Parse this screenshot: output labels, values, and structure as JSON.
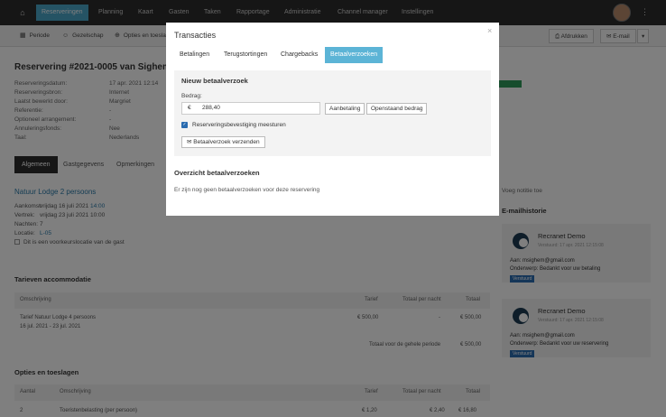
{
  "nav": {
    "items": [
      "Reserveringen",
      "Planning",
      "Kaart",
      "Gasten",
      "Taken",
      "Rapportage",
      "Administratie",
      "Channel manager",
      "Instellingen"
    ]
  },
  "subbar": {
    "periode": "Periode",
    "gezelschap": "Gezelschap",
    "opties": "Opties en toesla",
    "afdrukken": "Afdrukken",
    "email": "E-mail"
  },
  "reservation": {
    "title": "Reservering #2021-0005 van Sighem",
    "fields": [
      {
        "label": "Reserveringsdatum:",
        "value": "17 apr. 2021 12:14"
      },
      {
        "label": "Reserveringsbron:",
        "value": "Internet"
      },
      {
        "label": "Laatst bewerkt door:",
        "value": "Margriet"
      },
      {
        "label": "Referentie:",
        "value": "-"
      },
      {
        "label": "Optioneel arrangement:",
        "value": "-"
      },
      {
        "label": "Annuleringsfonds:",
        "value": "Nee"
      },
      {
        "label": "Taal:",
        "value": "Nederlands"
      }
    ],
    "tabs": [
      "Algemeen",
      "Gastgegevens",
      "Opmerkingen"
    ],
    "accommodation": "Natuur Lodge 2 persoons",
    "details": [
      {
        "label": "Aankomst:",
        "value": "vrijdag 16 juli 2021",
        "time": "14:00"
      },
      {
        "label": "Vertrek:",
        "value": "vrijdag 23 juli 2021 10:00",
        "time": ""
      },
      {
        "label": "Nachten:",
        "value": "7",
        "time": ""
      },
      {
        "label": "Locatie:",
        "value": "L-05",
        "time": ""
      }
    ],
    "preference": "Dit is een voorkeurslocatie van de gast"
  },
  "rates": {
    "title": "Tarieven accommodatie",
    "headers": [
      "Omschrijving",
      "Tarief",
      "Totaal per nacht",
      "Totaal"
    ],
    "row": {
      "desc": "Tarief Natuur Lodge 4 persoons",
      "dates": "16 jul. 2021 - 23 jul. 2021",
      "tarief": "€ 500,00",
      "per_nacht": "-",
      "totaal": "€ 500,00"
    },
    "total_label": "Totaal voor de gehele periode",
    "total_value": "€ 500,00"
  },
  "options": {
    "title": "Opties en toeslagen",
    "headers": [
      "Aantal",
      "Omschrijving",
      "Tarief",
      "Totaal per nacht",
      "Totaal"
    ],
    "row": {
      "aantal": "2",
      "desc": "Toeristenbelasting (per persoon)",
      "tarief": "€ 1,20",
      "per_nacht": "€ 2,40",
      "totaal": "€ 16,80"
    }
  },
  "right": {
    "add_note": "Voeg notitie toe",
    "history_title": "E-mailhistorie",
    "cards": [
      {
        "name": "Recranet Demo",
        "sent": "Verstuurd: 17 apr. 2021 12:15:08",
        "aan": "Aan: msighem@gmail.com",
        "onderwerp": "Onderwerp: Bedankt voor uw betaling",
        "badge": "Verstuurd"
      },
      {
        "name": "Recranet Demo",
        "sent": "Verstuurd: 17 apr. 2021 12:15:08",
        "aan": "Aan: msighem@gmail.com",
        "onderwerp": "Onderwerp: Bedankt voor uw reservering",
        "badge": "Verstuurd"
      }
    ]
  },
  "modal": {
    "title": "Transacties",
    "close": "×",
    "tabs": [
      "Betalingen",
      "Terugstortingen",
      "Chargebacks",
      "Betaalverzoeken"
    ],
    "active_tab": "Betaalverzoeken",
    "panel_title": "Nieuw betaalverzoek",
    "bedrag_label": "Bedrag:",
    "currency": "€",
    "amount": "288,40",
    "btn_aanbetaling": "Aanbetaling",
    "btn_openstaand": "Openstaand bedrag",
    "checkbox_label": "Reserveringsbevestiging meesturen",
    "send_button": "Betaalverzoek verzenden",
    "overview_title": "Overzicht betaalverzoeken",
    "overview_empty": "Er zijn nog geen betaalverzoeken voor deze reservering"
  }
}
